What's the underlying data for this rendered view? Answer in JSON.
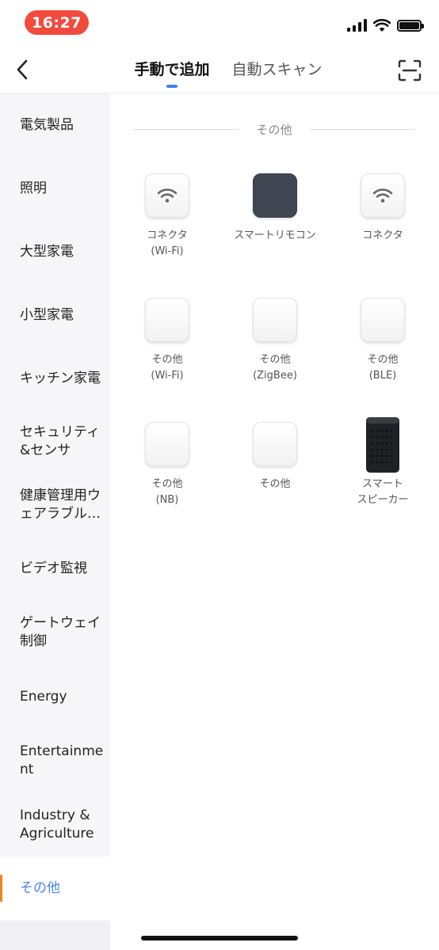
{
  "status_bar": {
    "time": "16:27"
  },
  "header": {
    "tabs": [
      {
        "label": "手動で追加",
        "active": true
      },
      {
        "label": "自動スキャン",
        "active": false
      }
    ],
    "icons": {
      "back": "chevron-left-icon",
      "scan": "scan-icon"
    }
  },
  "sidebar": {
    "items": [
      {
        "label": "電気製品"
      },
      {
        "label": "照明"
      },
      {
        "label": "大型家電"
      },
      {
        "label": "小型家電"
      },
      {
        "label": "キッチン家電"
      },
      {
        "label": "セキュリティ&センサ"
      },
      {
        "label": "健康管理用ウェアラブル…"
      },
      {
        "label": "ビデオ監視"
      },
      {
        "label": "ゲートウェイ制御"
      },
      {
        "label": "Energy"
      },
      {
        "label": "Entertainment"
      },
      {
        "label": "Industry & Agriculture"
      },
      {
        "label": "その他",
        "selected": true
      }
    ],
    "selected_color": "#4a86e8",
    "indicator_color": "#f5841f"
  },
  "content": {
    "section_title": "その他",
    "devices": [
      {
        "line1": "コネクタ",
        "line2": "(Wi-Fi)",
        "icon": "wifi-icon"
      },
      {
        "line1": "スマートリモコン",
        "line2": "",
        "icon": "remote-icon"
      },
      {
        "line1": "コネクタ",
        "line2": "",
        "icon": "wifi-icon"
      },
      {
        "line1": "その他",
        "line2": "(Wi-Fi)",
        "icon": "blank-device-icon"
      },
      {
        "line1": "その他",
        "line2": "(ZigBee)",
        "icon": "blank-device-icon"
      },
      {
        "line1": "その他",
        "line2": "(BLE)",
        "icon": "blank-device-icon"
      },
      {
        "line1": "その他",
        "line2": "(NB)",
        "icon": "blank-device-icon"
      },
      {
        "line1": "その他",
        "line2": "",
        "icon": "blank-device-icon"
      },
      {
        "line1": "スマート",
        "line2": "スピーカー",
        "icon": "speaker-icon"
      }
    ]
  }
}
